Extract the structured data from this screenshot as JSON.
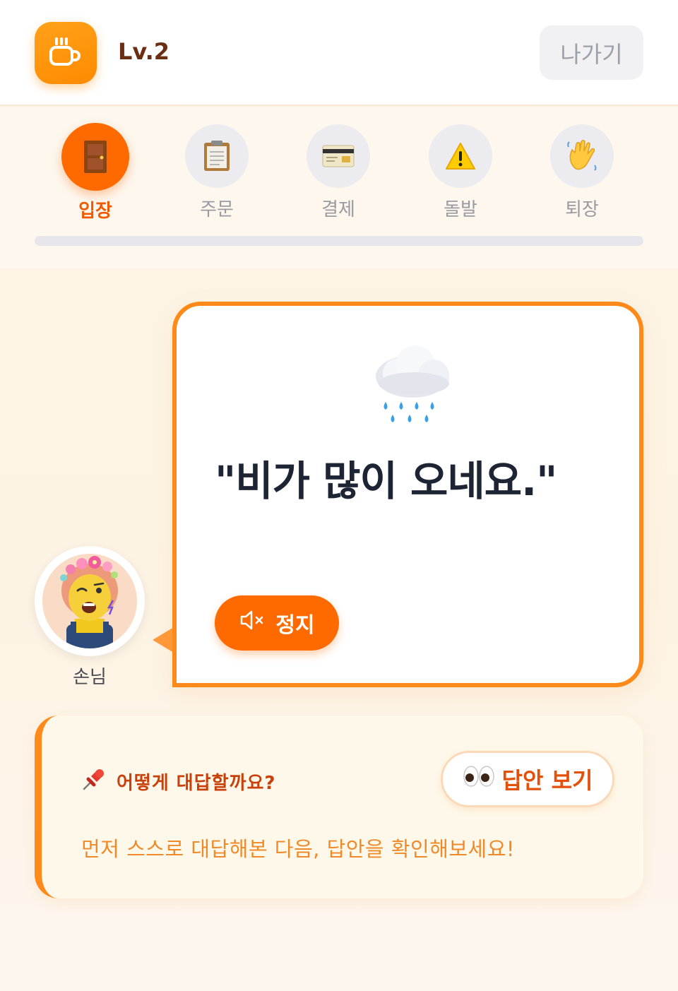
{
  "header": {
    "level": "Lv.2",
    "exit_label": "나가기",
    "logo_icon": "coffee-cup-icon"
  },
  "steps": [
    {
      "label": "입장",
      "icon": "door-icon",
      "active": true
    },
    {
      "label": "주문",
      "icon": "clipboard-icon",
      "active": false
    },
    {
      "label": "결제",
      "icon": "credit-card-icon",
      "active": false
    },
    {
      "label": "돌발",
      "icon": "warning-icon",
      "active": false
    },
    {
      "label": "퇴장",
      "icon": "waving-hand-icon",
      "active": false
    }
  ],
  "bubble": {
    "icon": "rain-cloud-icon",
    "phrase": "\"비가 많이 오네요.\"",
    "stop_label": "정지",
    "stop_icon": "mute-speaker-icon"
  },
  "customer": {
    "label": "손님",
    "avatar_icon": "customer-avatar-icon"
  },
  "hint": {
    "title": "어떻게 대답할까요?",
    "title_icon": "pushpin-icon",
    "answer_label": "답안 보기",
    "answer_icon": "eyes-icon",
    "description": "먼저 스스로 대답해본 다음, 답안을 확인해보세요!"
  },
  "colors": {
    "accent": "#ff6a00",
    "accent_light": "#ff8a1a",
    "level_text": "#6b2e12",
    "hint_text": "#f08a28"
  }
}
